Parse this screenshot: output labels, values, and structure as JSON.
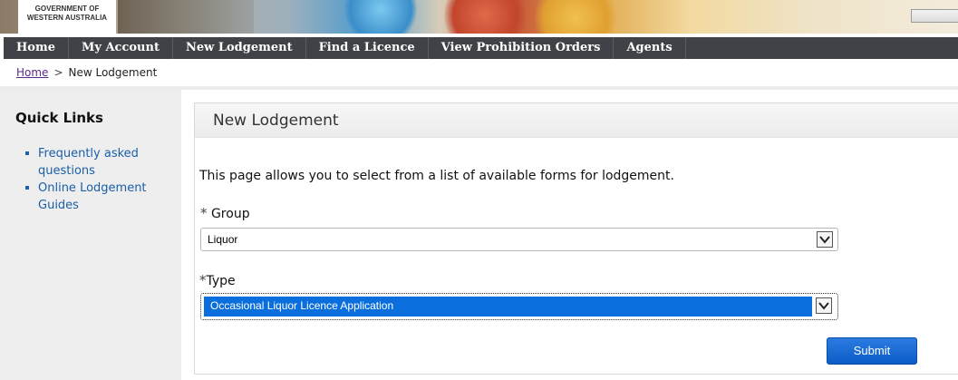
{
  "header": {
    "logo_line1": "GOVERNMENT OF",
    "logo_line2": "WESTERN AUSTRALIA"
  },
  "nav": {
    "items": [
      "Home",
      "My Account",
      "New Lodgement",
      "Find a Licence",
      "View Prohibition Orders",
      "Agents"
    ]
  },
  "breadcrumb": {
    "home": "Home",
    "separator": ">",
    "current": "New Lodgement"
  },
  "sidebar": {
    "title": "Quick Links",
    "links": [
      "Frequently asked questions",
      "Online Lodgement Guides"
    ]
  },
  "main": {
    "title": "New Lodgement",
    "intro": "This page allows you to select from a list of available forms for lodgement.",
    "group_label": "Group",
    "group_required": "*",
    "group_value": "Liquor",
    "type_label": "Type",
    "type_required": "*",
    "type_value": "Occasional Liquor Licence Application",
    "submit_label": "Submit"
  },
  "colors": {
    "nav_bg": "#3f4347",
    "link": "#1a5fa8",
    "selection": "#0a6fdc",
    "button": "#0b5cc7"
  }
}
